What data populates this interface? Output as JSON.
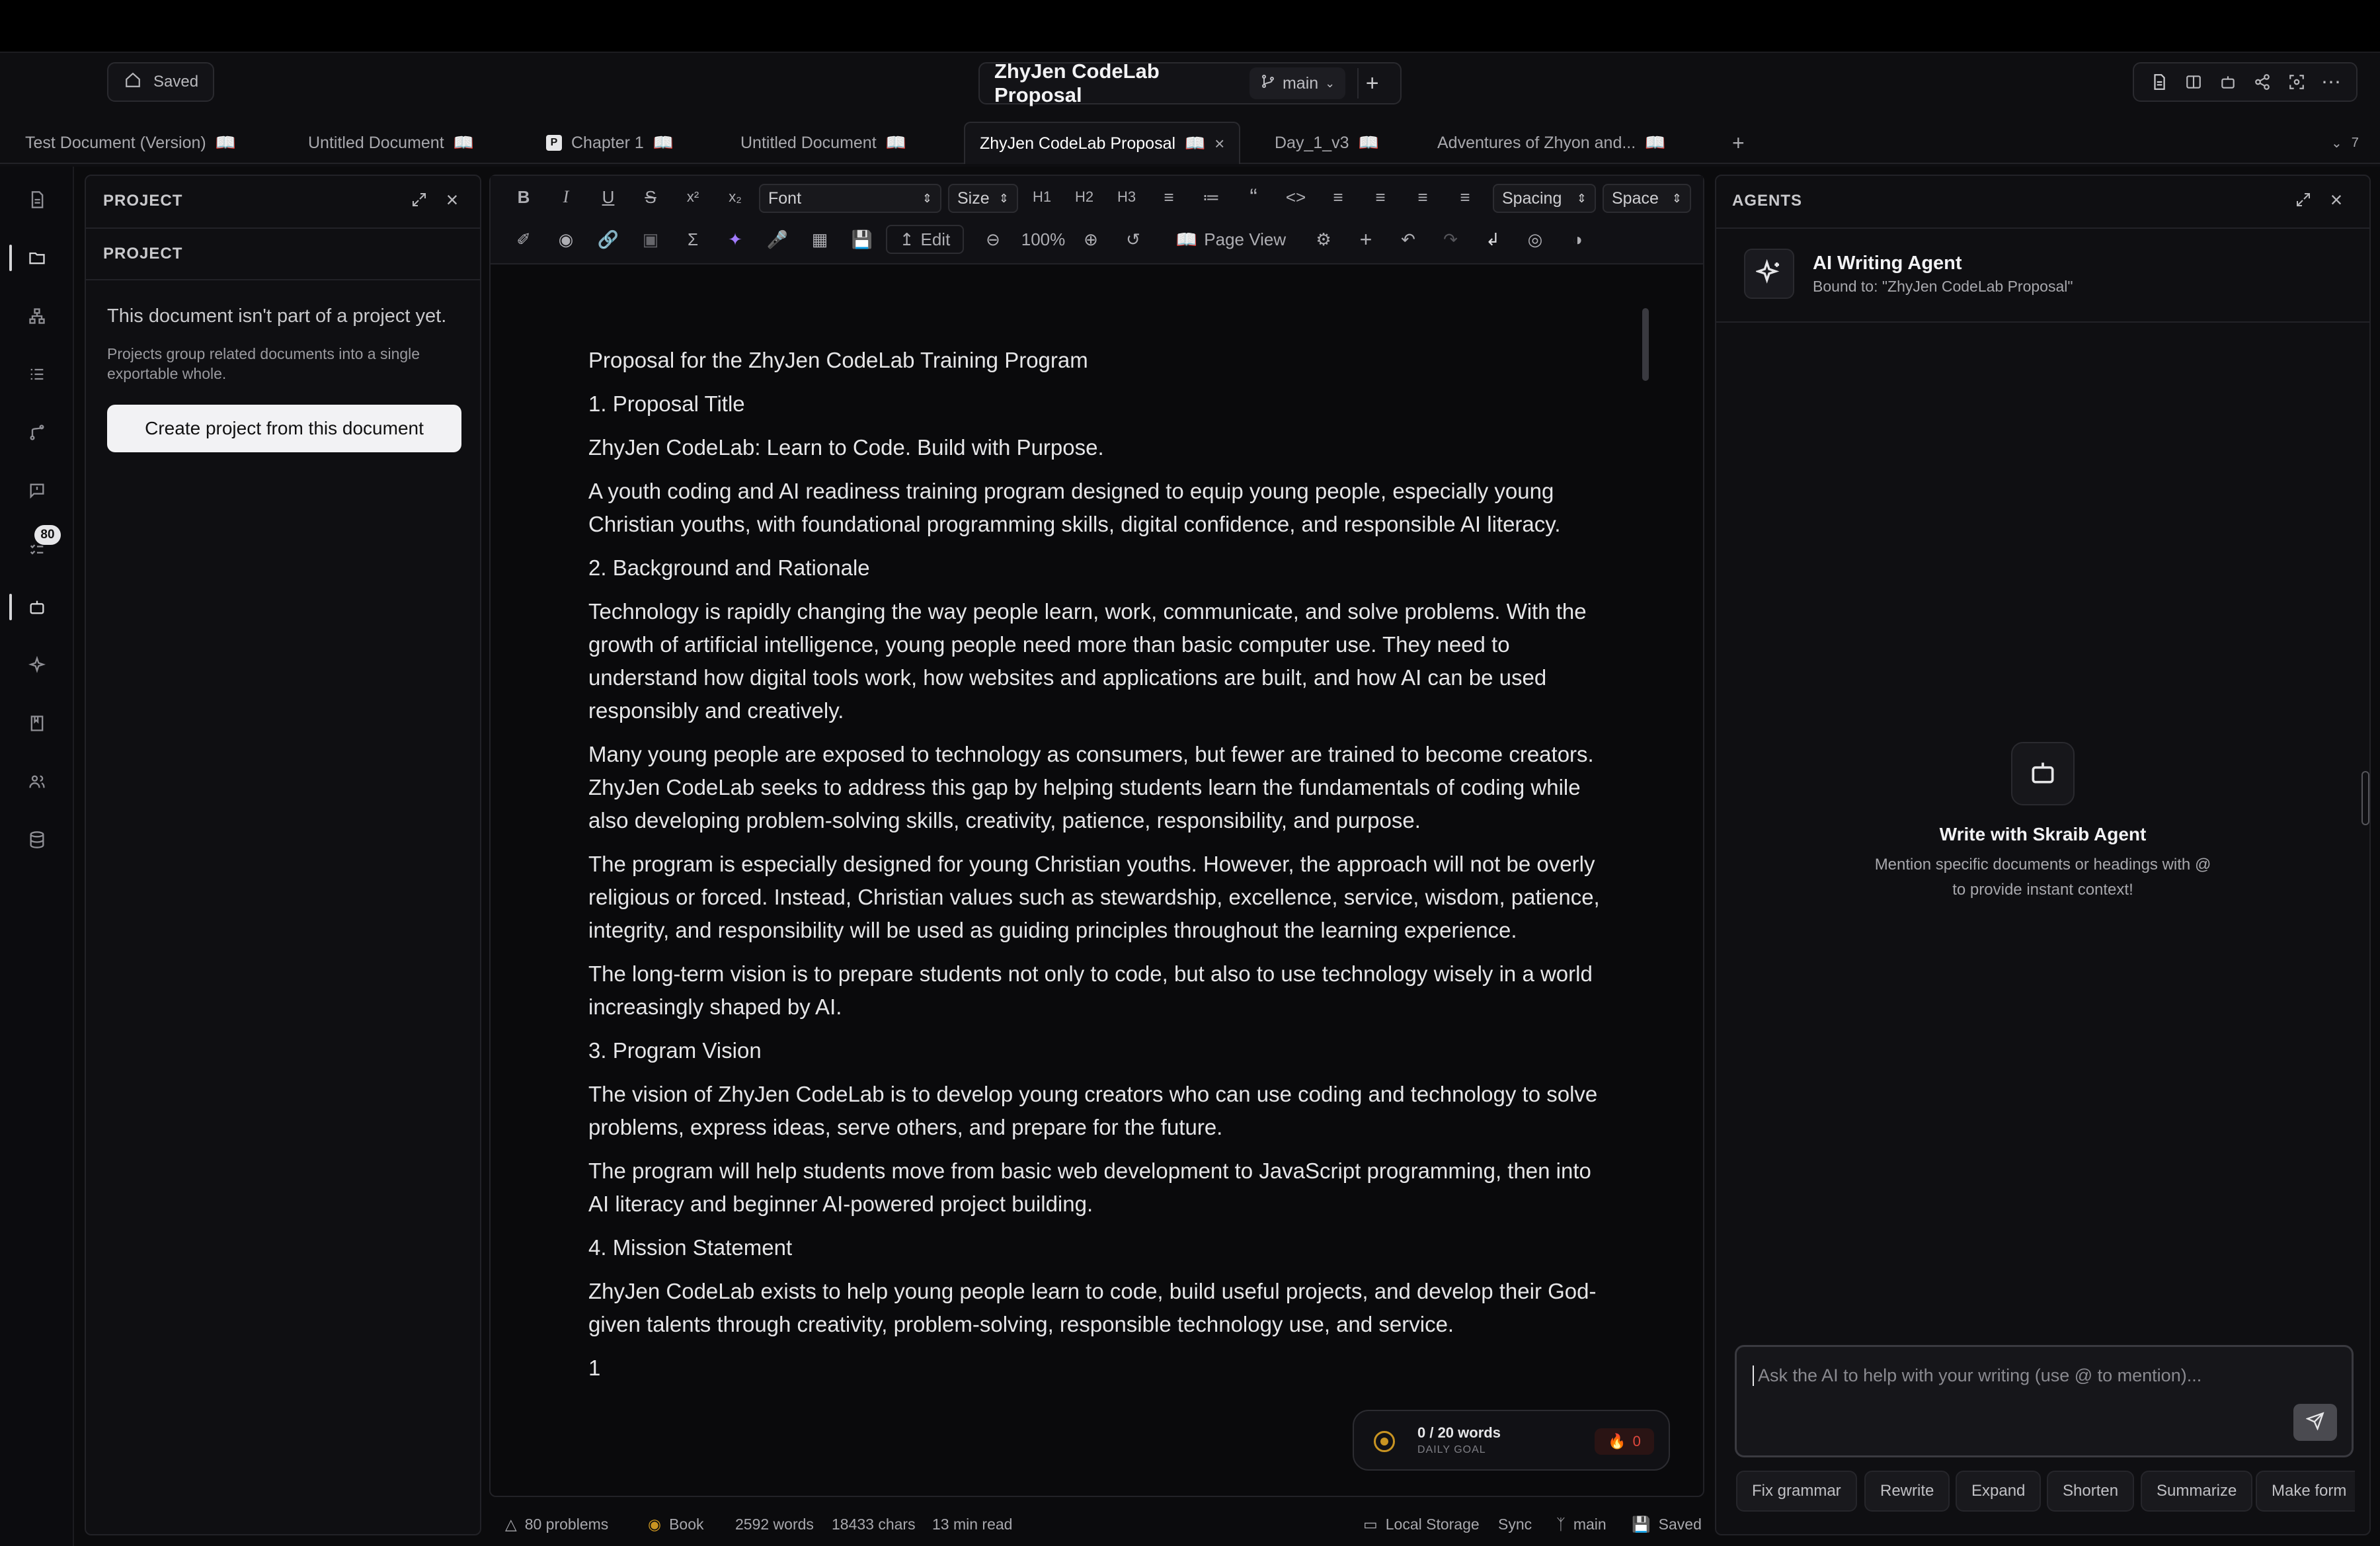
{
  "header": {
    "saved_label": "Saved",
    "doc_title": "ZhyJen CodeLab Proposal",
    "branch": "main"
  },
  "tabs": [
    {
      "label": "Test Document (Version)"
    },
    {
      "label": "Untitled Document"
    },
    {
      "label": "Chapter 1",
      "badge": "P"
    },
    {
      "label": "Untitled Document"
    },
    {
      "label": "ZhyJen CodeLab Proposal",
      "active": true
    },
    {
      "label": "Day_1_v3"
    },
    {
      "label": "Adventures of Zhyon and..."
    }
  ],
  "tab_count": "7",
  "sidebar": {
    "problems_badge": "80"
  },
  "project_panel": {
    "header": "PROJECT",
    "section": "PROJECT",
    "empty_title": "This document isn't part of a project yet.",
    "empty_desc": "Projects group related documents into a single exportable whole.",
    "create_button": "Create project from this document"
  },
  "toolbar": {
    "font_select": "Font",
    "size_select": "Size",
    "h1": "H1",
    "h2": "H2",
    "h3": "H3",
    "spacing_select": "Spacing",
    "space_select": "Space",
    "edit_label": "Edit",
    "zoom": "100%",
    "page_view_label": "Page View"
  },
  "document": {
    "paragraphs": [
      "Proposal for the ZhyJen CodeLab Training Program",
      "1.  Proposal Title",
      "ZhyJen CodeLab: Learn to Code. Build with Purpose.",
      "A youth coding and AI readiness training program designed to equip young people, especially young Christian youths, with foundational programming skills, digital confidence, and responsible AI literacy.",
      "2.  Background and Rationale",
      "Technology is rapidly changing the way people learn, work, communicate, and solve problems. With the growth of artificial intelligence, young people need more than basic computer use. They need to understand how digital tools work, how websites and applications are built, and how AI can be used responsibly and creatively.",
      "Many young people are exposed to technology as consumers, but fewer are trained to become creators. ZhyJen CodeLab seeks to address this gap by helping students learn the fundamentals of coding while also developing problem-solving skills, creativity, patience, responsibility, and purpose.",
      "The program is especially designed for young Christian youths. However, the approach will not be overly religious or forced. Instead, Christian values such as stewardship, excellence, service, wisdom, patience, integrity, and responsibility will be used as guiding principles throughout the learning experience.",
      "The long-term vision is to prepare students not only to code, but also to use technology wisely in a world increasingly shaped by AI.",
      "3.  Program Vision",
      "The vision of ZhyJen CodeLab is to develop young creators who can use coding and technology to solve problems, express ideas, serve others, and prepare for the future.",
      "The program will help students move from basic web development to JavaScript programming, then into AI literacy and beginner AI-powered project building.",
      "4.  Mission Statement",
      "ZhyJen CodeLab exists to help young people learn to code, build useful projects, and develop their God-given talents through creativity, problem-solving, responsible technology use, and service.",
      "1"
    ]
  },
  "daily_goal": {
    "words": "0 / 20 words",
    "label": "DAILY GOAL",
    "streak": "0"
  },
  "status_bar": {
    "problems": "80 problems",
    "mode": "Book",
    "words": "2592 words",
    "chars": "18433 chars",
    "read_time": "13 min read",
    "storage": "Local Storage",
    "sync": "Sync",
    "branch": "main",
    "saved": "Saved"
  },
  "agents_panel": {
    "header": "AGENTS",
    "agent_name": "AI Writing Agent",
    "bound_to": "Bound to: \"ZhyJen CodeLab Proposal\"",
    "empty_title": "Write with Skraib Agent",
    "empty_line1": "Mention specific documents or headings with @",
    "empty_line2": "to provide instant context!",
    "input_placeholder": "Ask the AI to help with your writing (use @ to mention)...",
    "chips": [
      "Fix grammar",
      "Rewrite",
      "Expand",
      "Shorten",
      "Summarize",
      "Make form"
    ]
  },
  "colors": {
    "accent_purple": "#a27bff",
    "goal_amber": "#c99422",
    "streak_red": "#e0483e"
  }
}
